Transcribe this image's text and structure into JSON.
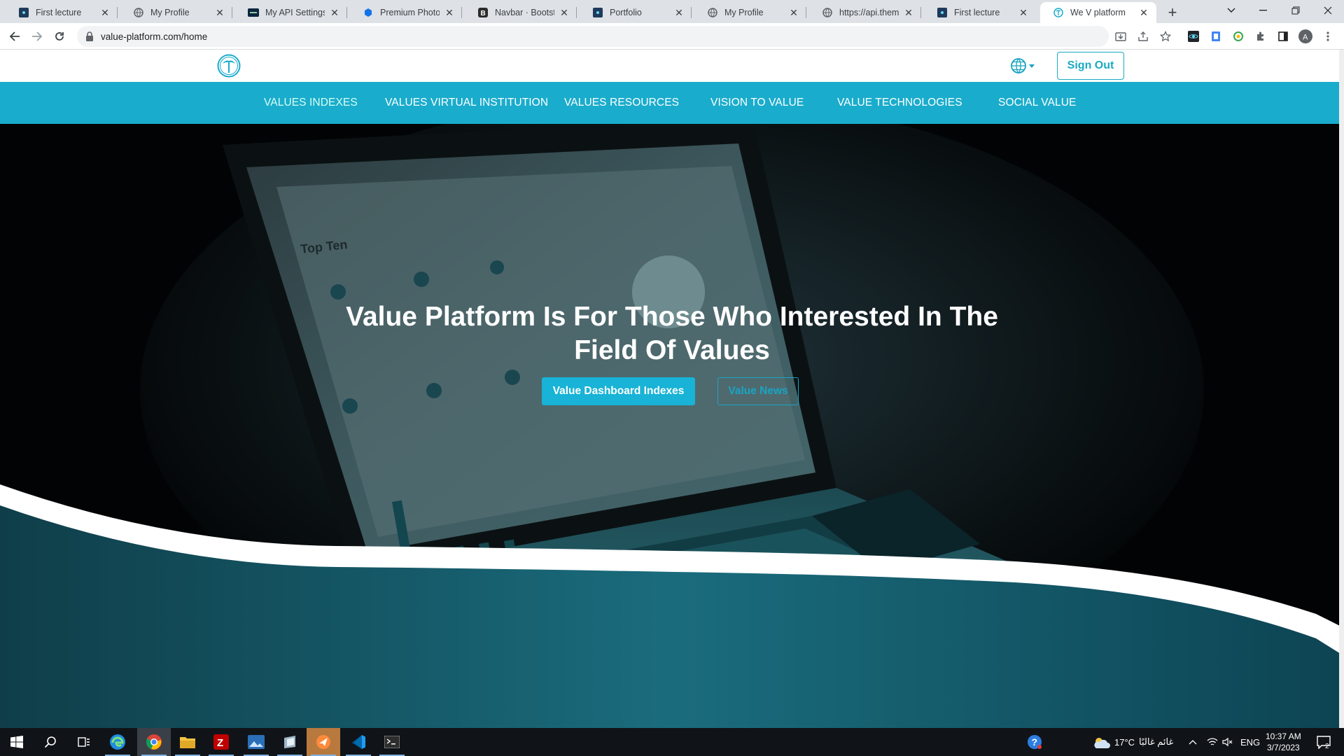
{
  "browser": {
    "tabs": [
      {
        "title": "First lecture",
        "icon": "react-icon"
      },
      {
        "title": "My Profile",
        "icon": "globe-icon"
      },
      {
        "title": "My API Settings — ",
        "icon": "tmdb-icon"
      },
      {
        "title": "Premium Photo | F",
        "icon": "freepik-icon"
      },
      {
        "title": "Navbar · Bootstrap",
        "icon": "bootstrap-icon"
      },
      {
        "title": "Portfolio",
        "icon": "react-icon"
      },
      {
        "title": "My Profile",
        "icon": "globe-icon"
      },
      {
        "title": "https://api.themov",
        "icon": "globe-icon"
      },
      {
        "title": "First lecture",
        "icon": "react-icon"
      },
      {
        "title": "We V platform",
        "icon": "palm-icon",
        "active": true
      }
    ],
    "url": "value-platform.com/home"
  },
  "header": {
    "logo": "palm-tree-logo",
    "language_icon": "globe-icon",
    "sign_out_label": "Sign Out"
  },
  "nav": {
    "items": [
      {
        "label": "VALUES INDEXES",
        "active": true
      },
      {
        "label": "VALUES VIRTUAL INSTITUTION"
      },
      {
        "label": "VALUES RESOURCES"
      },
      {
        "label": "VISION TO VALUE"
      },
      {
        "label": "VALUE TECHNOLOGIES"
      },
      {
        "label": "SOCIAL VALUE"
      }
    ]
  },
  "hero": {
    "title_line1": "Value Platform Is For Those Who Interested In The",
    "title_line2": "Field Of Values",
    "primary_button": "Value Dashboard Indexes",
    "secondary_button": "Value News",
    "background_text": "Top Ten"
  },
  "taskbar": {
    "weather": "17°C",
    "weather_text": "غائم غالبًا",
    "language": "ENG",
    "time": "10:37 AM",
    "date": "3/7/2023",
    "notifications": "2"
  },
  "colors": {
    "brand": "#1aaccc",
    "button": "#18b3d6",
    "taskbar": "#101418"
  }
}
